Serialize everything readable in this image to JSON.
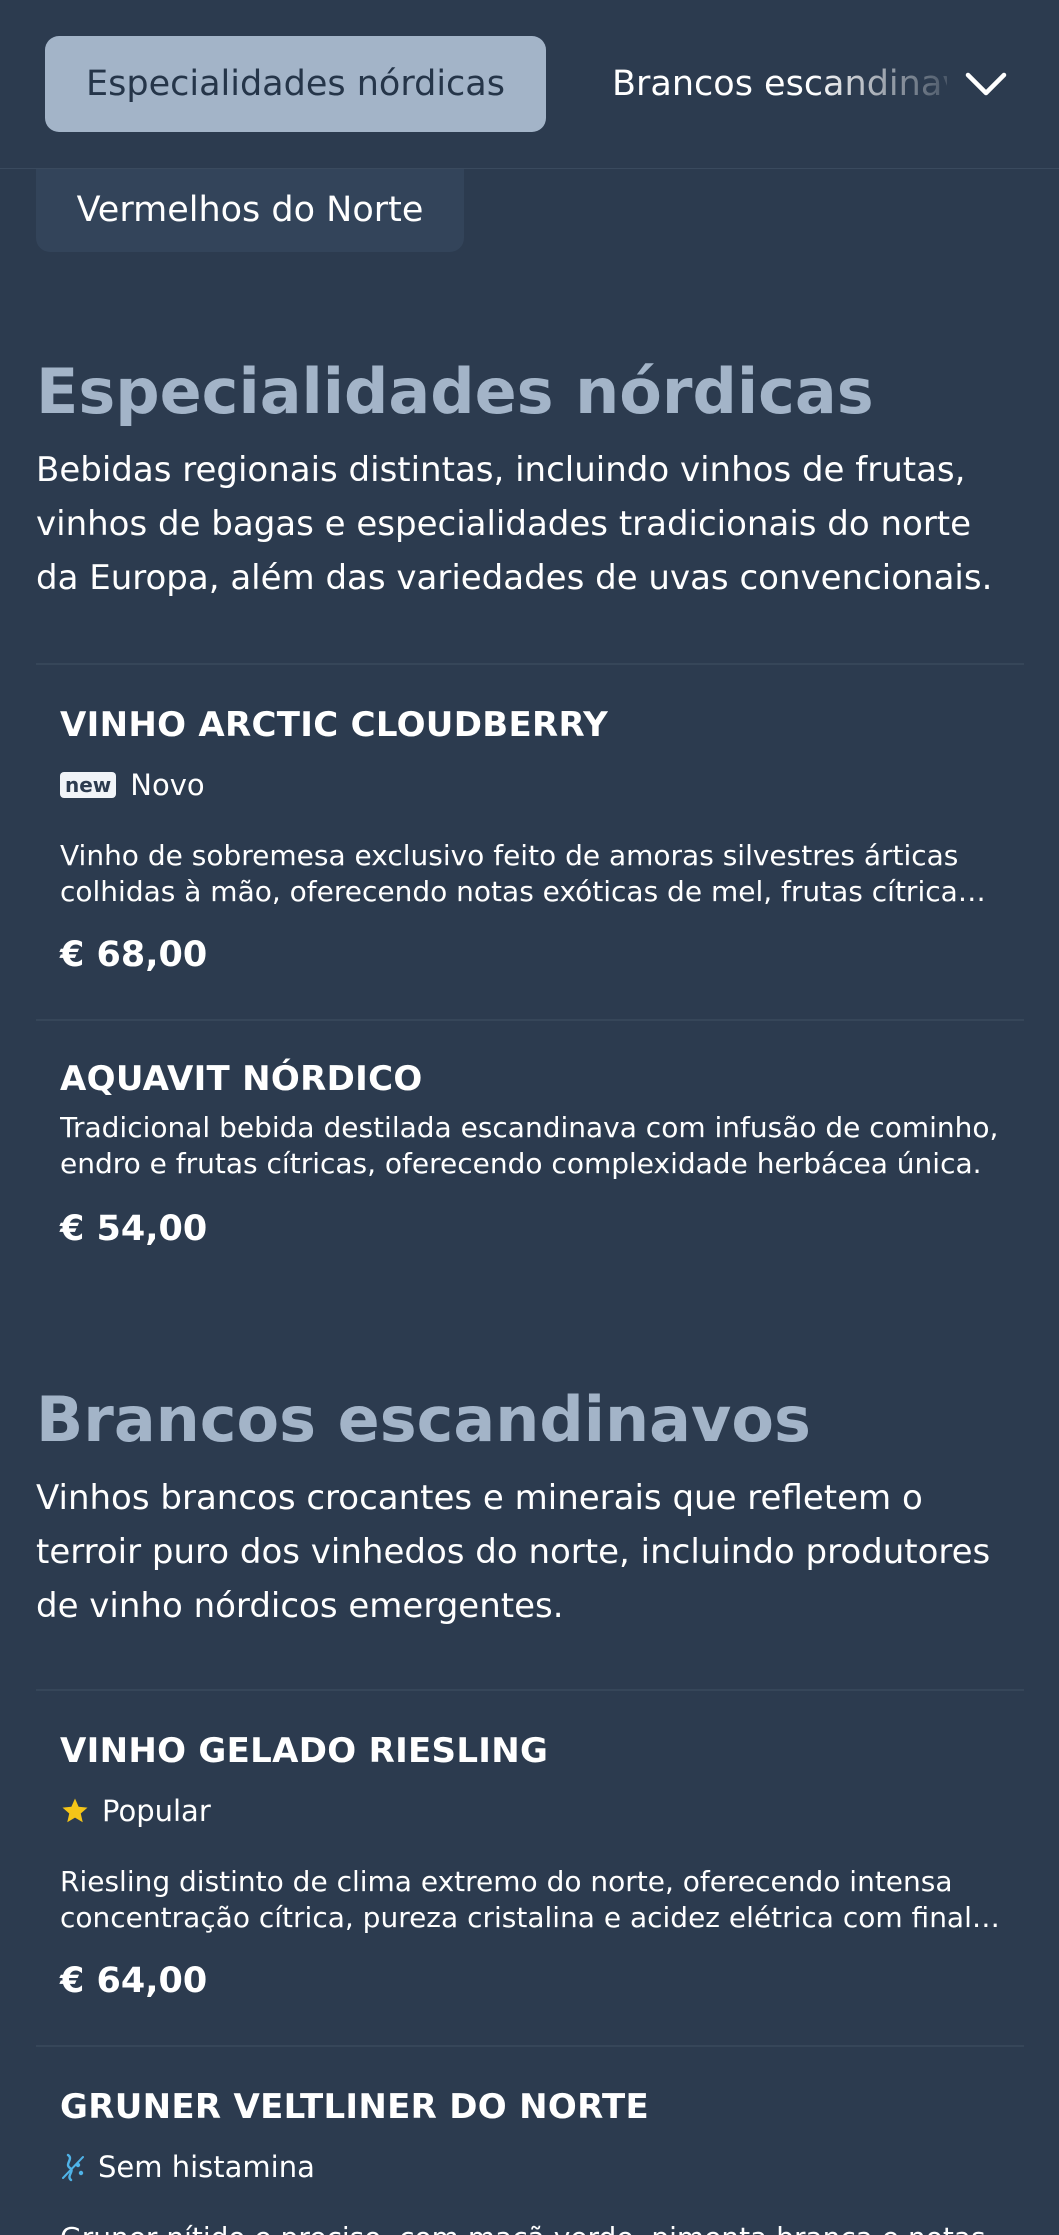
{
  "nav": {
    "active_tab": "Especialidades nórdicas",
    "next_tab": "Brancos escandinavos",
    "third_tab": "Vermelhos do Norte",
    "expand_icon": "chevron-down-icon"
  },
  "sections": [
    {
      "title": "Especialidades nórdicas",
      "description": "Bebidas regionais distintas, incluindo vinhos de frutas, vinhos de bagas e especialidades tradicionais do norte da Europa, além das variedades de uvas convencionais.",
      "items": [
        {
          "name": "VINHO ARCTIC CLOUDBERRY",
          "badge_chip": "new",
          "badge_label": "Novo",
          "description": "Vinho de sobremesa exclusivo feito de amoras silvestres árticas colhidas à mão, oferecendo notas exóticas de mel, frutas cítricas e flores silvestres.",
          "price": "€ 68,00"
        },
        {
          "name": "AQUAVIT NÓRDICO",
          "description": "Tradicional bebida destilada escandinava com infusão de cominho, endro e frutas cítricas, oferecendo complexidade herbácea única.",
          "price": "€ 54,00"
        }
      ]
    },
    {
      "title": "Brancos escandinavos",
      "description": "Vinhos brancos crocantes e minerais que refletem o terroir puro dos vinhedos do norte, incluindo produtores de vinho nórdicos emergentes.",
      "items": [
        {
          "name": "VINHO GELADO RIESLING",
          "badge_icon": "star-icon",
          "badge_label": "Popular",
          "description": "Riesling distinto de clima extremo do norte, oferecendo intensa concentração cítrica, pureza cristalina e acidez elétrica com final longo.",
          "price": "€ 64,00"
        },
        {
          "name": "GRUNER VELTLINER DO NORTE",
          "badge_icon": "histamine-free-icon",
          "badge_label": "Sem histamina",
          "description": "Gruner nítido e preciso, com maçã verde, pimenta branca e notas minerais marcantes.",
          "price": ""
        }
      ]
    }
  ],
  "colors": {
    "background": "#2c3b4f",
    "accent": "#a3b4c8",
    "star": "#f5c518",
    "histamine_icon": "#4fb3e8"
  }
}
